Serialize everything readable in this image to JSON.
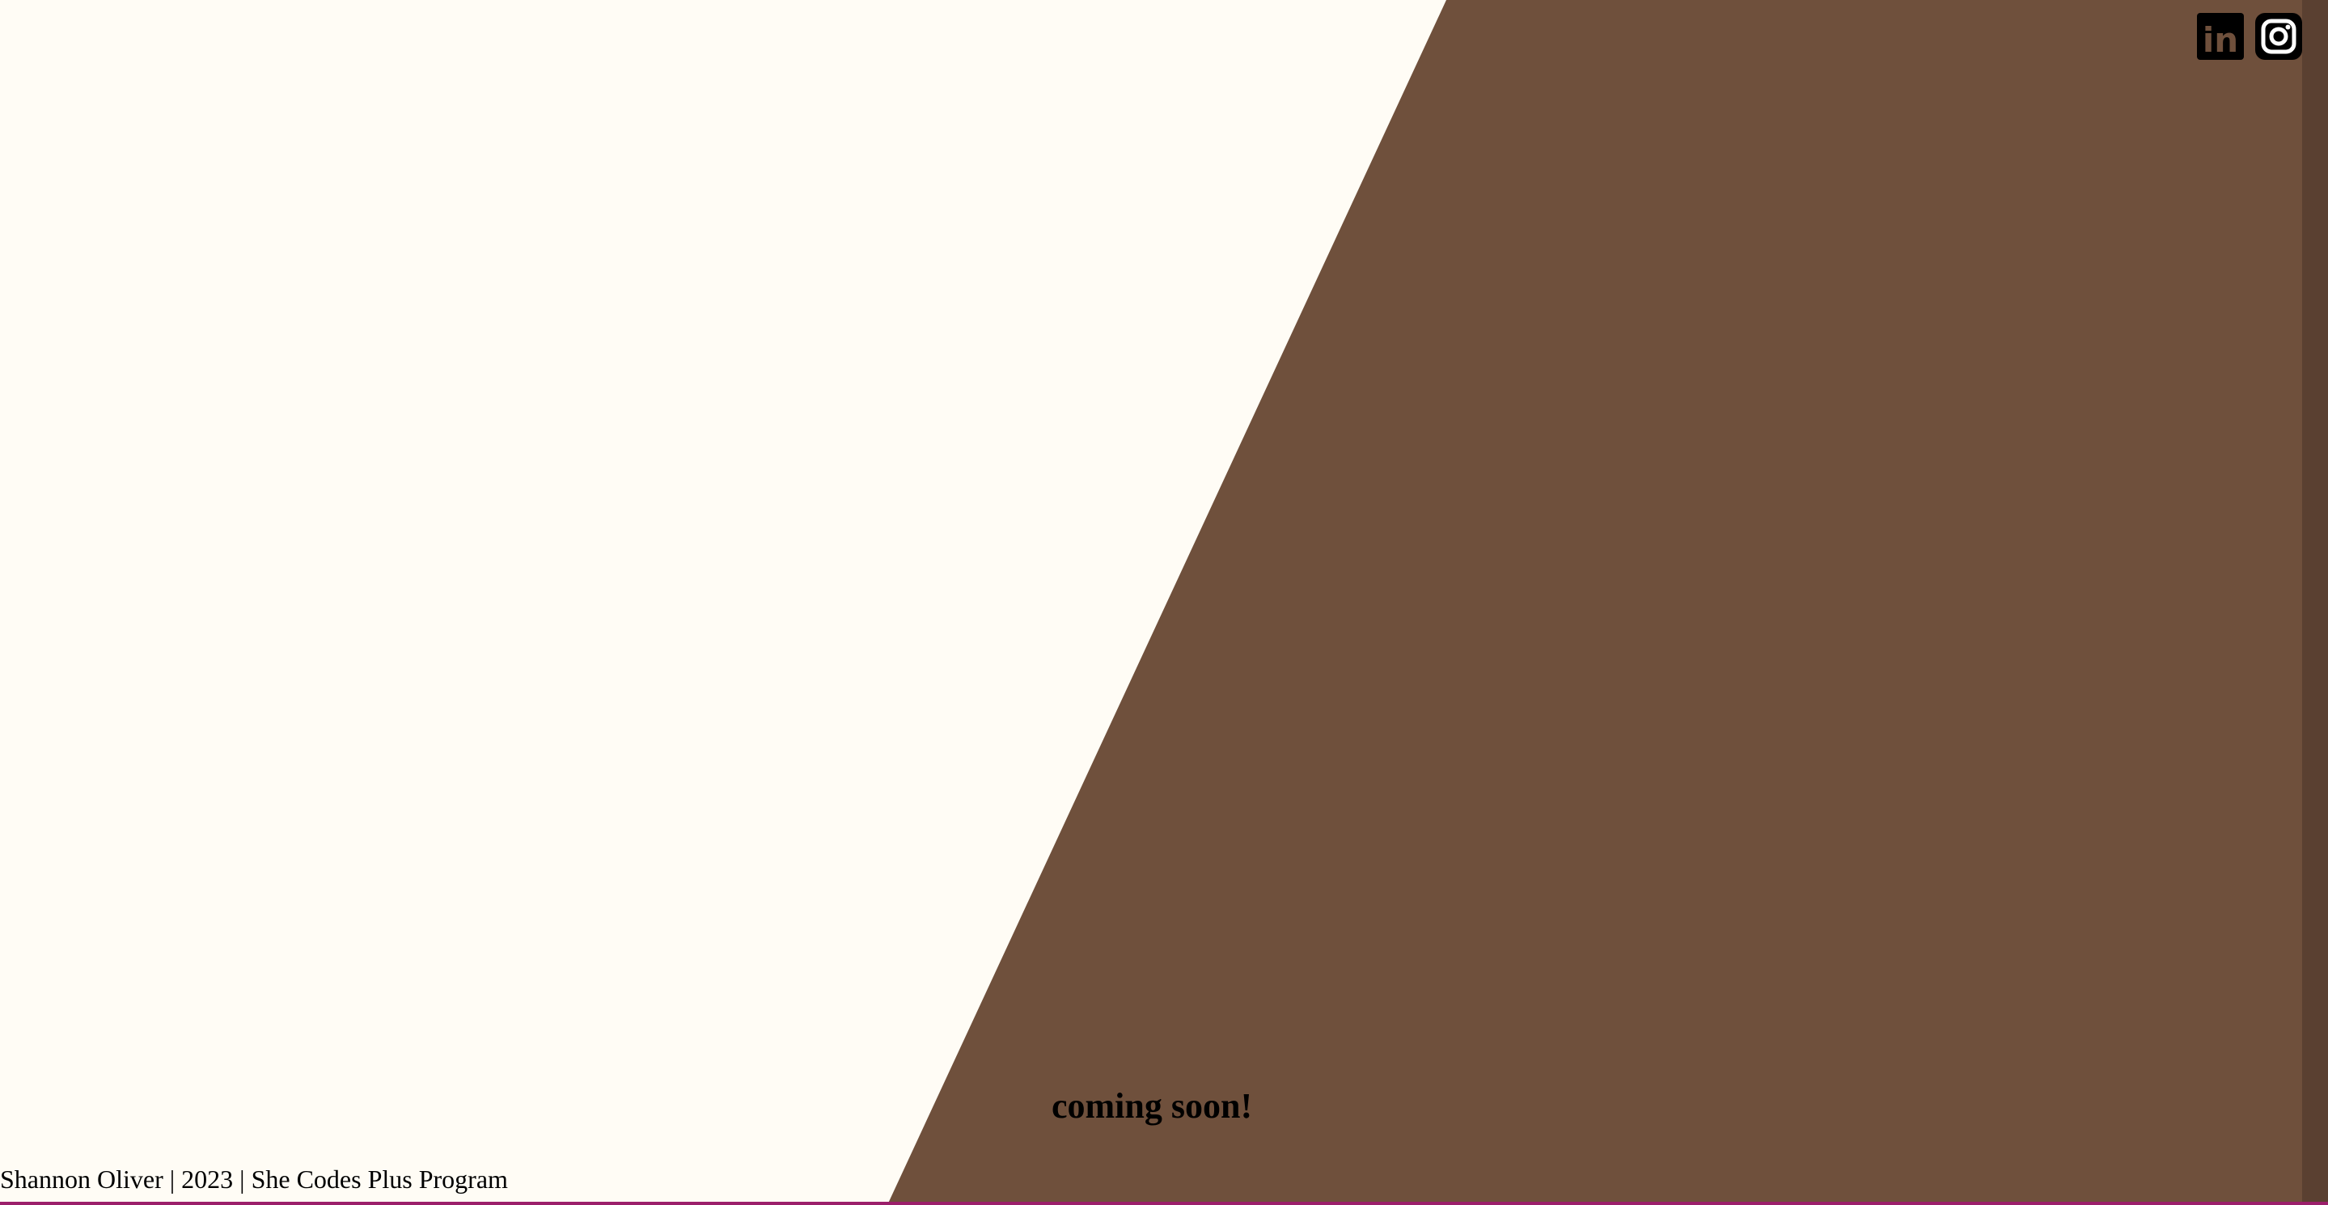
{
  "social": {
    "icons": [
      "linkedin-icon",
      "instagram-icon"
    ],
    "linkedin_label": "in"
  },
  "main": {
    "coming_soon": "coming soon!"
  },
  "footer": {
    "text": "Shannon Oliver | 2023 | She Codes Plus Program"
  },
  "colors": {
    "background": "#fffcf5",
    "panel": "#6f503c",
    "bottom_line": "#9b1f6b",
    "icon": "#000000"
  }
}
